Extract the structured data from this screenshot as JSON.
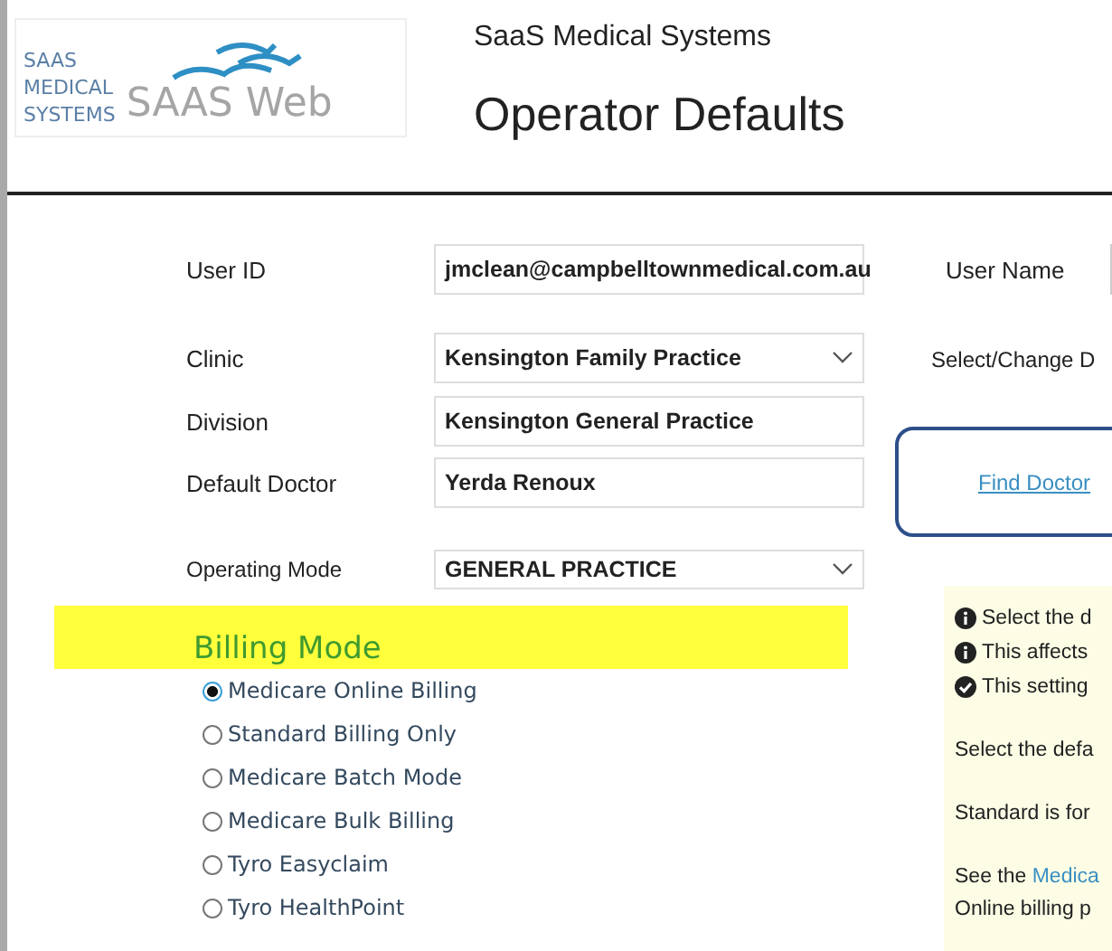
{
  "logo": {
    "company_lines": [
      "SAAS",
      "MEDICAL",
      "SYSTEMS"
    ],
    "product": "SAAS Web"
  },
  "header": {
    "company": "SaaS Medical Systems",
    "title": "Operator Defaults"
  },
  "fields": [
    {
      "label": "User ID",
      "value": "jmclean@campbelltownmedical.com.au",
      "kind": "text"
    },
    {
      "label": "Clinic",
      "value": "Kensington Family Practice",
      "kind": "select"
    },
    {
      "label": "Division",
      "value": "Kensington General Practice",
      "kind": "text"
    },
    {
      "label": "Default Doctor",
      "value": "Yerda Renoux",
      "kind": "text"
    },
    {
      "label": "Operating Mode",
      "value": "GENERAL PRACTICE",
      "kind": "select"
    }
  ],
  "right": {
    "user_name_label": "User Name",
    "select_change_label": "Select/Change D",
    "find_doctor_link": "Find Doctor"
  },
  "billing": {
    "heading": "Billing Mode",
    "options": [
      {
        "label": "Medicare Online Billing",
        "selected": true
      },
      {
        "label": "Standard Billing Only",
        "selected": false
      },
      {
        "label": "Medicare Batch Mode",
        "selected": false
      },
      {
        "label": "Medicare Bulk Billing",
        "selected": false
      },
      {
        "label": "Tyro Easyclaim",
        "selected": false
      },
      {
        "label": "Tyro HealthPoint",
        "selected": false
      }
    ]
  },
  "help": {
    "bullets": [
      {
        "kind": "info",
        "text": "Select the d"
      },
      {
        "kind": "info",
        "text": "This affects"
      },
      {
        "kind": "check",
        "text": "This setting"
      }
    ],
    "paragraphs": [
      {
        "parts": [
          {
            "text": "Select the defa"
          }
        ]
      },
      {
        "parts": [
          {
            "text": "Standard is for"
          }
        ]
      },
      {
        "parts": [
          {
            "text": "See the "
          },
          {
            "text": "Medica",
            "link": true
          }
        ],
        "second_line": "Online billing p"
      }
    ]
  }
}
